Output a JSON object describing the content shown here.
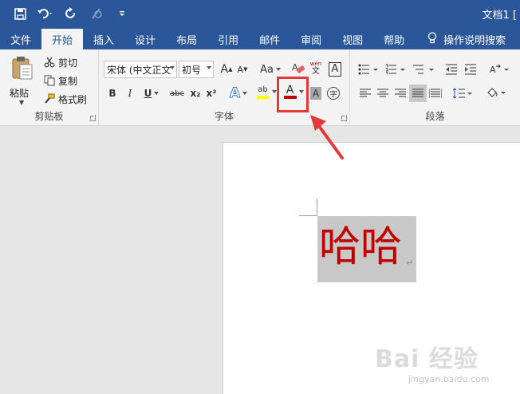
{
  "window": {
    "title": "文档1 [",
    "title_bar_color": "#2b579a"
  },
  "quick_access": {
    "icons": [
      "save-icon",
      "undo-icon",
      "redo-icon",
      "format-painter-disabled-icon",
      "customize-qat-icon"
    ]
  },
  "tabs": [
    {
      "label": "文件",
      "active": false
    },
    {
      "label": "开始",
      "active": true
    },
    {
      "label": "插入",
      "active": false
    },
    {
      "label": "设计",
      "active": false
    },
    {
      "label": "布局",
      "active": false
    },
    {
      "label": "引用",
      "active": false
    },
    {
      "label": "邮件",
      "active": false
    },
    {
      "label": "审阅",
      "active": false
    },
    {
      "label": "视图",
      "active": false
    },
    {
      "label": "帮助",
      "active": false
    }
  ],
  "tell_me": {
    "label": "操作说明搜索"
  },
  "clipboard": {
    "group_label": "剪贴板",
    "paste_label": "粘贴",
    "cut_label": "剪切",
    "copy_label": "复制",
    "format_painter_label": "格式刷"
  },
  "font": {
    "group_label": "字体",
    "font_name": "宋体 (中文正文",
    "font_size": "初号",
    "grow_label": "A",
    "shrink_label": "A",
    "case_label": "Aa",
    "phonetic_top": "wén",
    "phonetic_bottom": "文",
    "char_border_label": "A",
    "bold_label": "B",
    "italic_label": "I",
    "underline_label": "U",
    "strikethrough_label": "abc",
    "subscript_label": "x₂",
    "superscript_label": "x²",
    "text_effect_label": "A",
    "highlight_label": "ab",
    "font_color_label": "A",
    "font_color": "#c00000",
    "highlight_color": "#ffff00",
    "char_shading_label": "A",
    "enclose_label": "字"
  },
  "paragraph": {
    "group_label": "段落"
  },
  "document": {
    "text": "哈哈",
    "text_color": "#c00000",
    "paragraph_mark": "↵"
  },
  "annotation": {
    "box_color": "#e03a3a"
  },
  "watermark": {
    "text": "Bai 经验",
    "sub": "jingyan.baidu.com"
  }
}
